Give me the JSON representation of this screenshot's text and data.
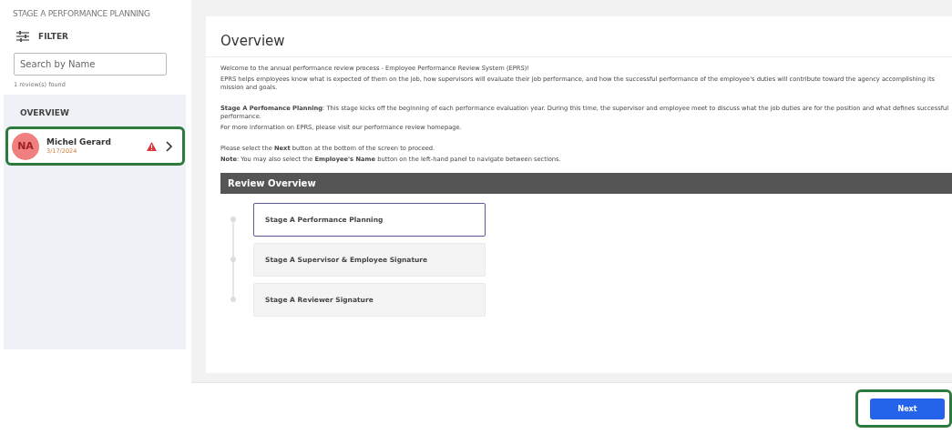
{
  "sidebar": {
    "title": "STAGE A PERFORMANCE PLANNING",
    "filter_label": "FILTER",
    "search": {
      "placeholder": "Search by Name"
    },
    "result_count": "1 review(s) found",
    "section": "OVERVIEW",
    "employees": [
      {
        "initials": "NA",
        "name": "Michel Gerard",
        "date": "3/17/2024",
        "warning": true,
        "highlighted": true,
        "color": "#f08080"
      }
    ]
  },
  "main": {
    "title": "Overview",
    "paragraph_groups": [
      [
        "Welcome to the annual performance review process - Employee Performance Review System (EPRS)!",
        "EPRS helps employees know what is expected of them on the job, how supervisors will evaluate their job performance, and how the successful performance of the employee's duties will contribute toward the agency accomplishing its mission and goals."
      ],
      [
        "**Stage A Perfomance Planning**: This stage kicks off the beginning of each performance evaluation year. During this time, the supervisor and employee meet to discuss what the job duties are for the position and what defines successful performance.",
        "For more information on EPRS, please visit our performance review homepage."
      ],
      [
        "Please select the **Next** button at the bottom of the screen to proceed.",
        "**Note**: You may also select the **Employee's Name** button on the left-hand panel to navigate between sections."
      ]
    ],
    "review_header": "Review Overview",
    "stages": [
      {
        "label": "Stage A Performance Planning",
        "selected": true
      },
      {
        "label": "Stage A Supervisor & Employee Signature",
        "selected": false
      },
      {
        "label": "Stage A Reviewer Signature",
        "selected": false
      }
    ]
  },
  "footer": {
    "next_button": {
      "label": "Next",
      "highlighted": true
    }
  }
}
